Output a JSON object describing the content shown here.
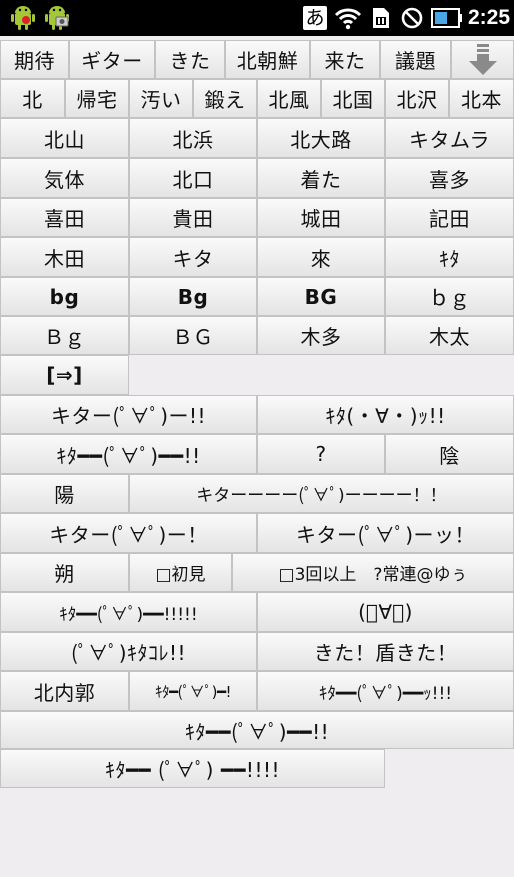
{
  "status_bar": {
    "icons": [
      "android-robot-icon",
      "android-robot-camera-icon",
      "ime-icon",
      "wifi-icon",
      "sim-icon",
      "no-signal-icon",
      "battery-icon"
    ],
    "ime_char": "あ",
    "time": "2:25",
    "colors": {
      "background": "#000000",
      "wifi": "#ffffff",
      "battery": "#4aa7e6"
    }
  },
  "candidate_rows": [
    [
      "期待",
      "ギター",
      "きた",
      "北朝鮮",
      "来た",
      "議題"
    ],
    [
      "北",
      "帰宅",
      "汚い",
      "鍛え",
      "北風",
      "北国",
      "北沢",
      "北本"
    ],
    [
      "北山",
      "北浜",
      "北大路",
      "キタムラ"
    ],
    [
      "気体",
      "北口",
      "着た",
      "喜多"
    ],
    [
      "喜田",
      "貴田",
      "城田",
      "記田"
    ],
    [
      "木田",
      "キタ",
      "來",
      "ｷﾀ"
    ],
    [
      "bg",
      "Bg",
      "BG",
      "ｂｇ"
    ],
    [
      "Ｂｇ",
      "ＢＧ",
      "木多",
      "木太"
    ],
    [
      "[⇒]"
    ],
    [
      "キター(ﾟ∀ﾟ)ー!!",
      "ｷﾀ(・∀・)ｯ!!"
    ],
    [
      "ｷﾀ━━(ﾟ∀ﾟ)━━!!",
      "?",
      "陰"
    ],
    [
      "陽",
      "キターーーー(ﾟ∀ﾟ)ーーーー！！"
    ],
    [
      "キター(ﾟ∀ﾟ)ー！",
      "キター(ﾟ∀ﾟ)ーッ！"
    ],
    [
      "朔",
      "□初見",
      "□3回以上　?常連@ゆぅ"
    ],
    [
      "ｷﾀ━━(ﾟ∀ﾟ)━━!!!!!",
      "(ﾟ∀ﾟ)"
    ],
    [
      "(ﾟ∀ﾟ)ｷﾀｺﾚ!!",
      "きた！盾きた！"
    ],
    [
      "北内郭",
      "ｷﾀ━(ﾟ∀ﾟ)━!",
      "ｷﾀ━━(ﾟ∀ﾟ)━━ｯ!!!"
    ],
    [
      "ｷﾀ━━(ﾟ∀ﾟ)━━!!"
    ],
    [
      "ｷﾀ━━ (ﾟ∀ﾟ) ━━!!!!"
    ]
  ],
  "expand_button": {
    "icon": "arrow-down-icon"
  }
}
